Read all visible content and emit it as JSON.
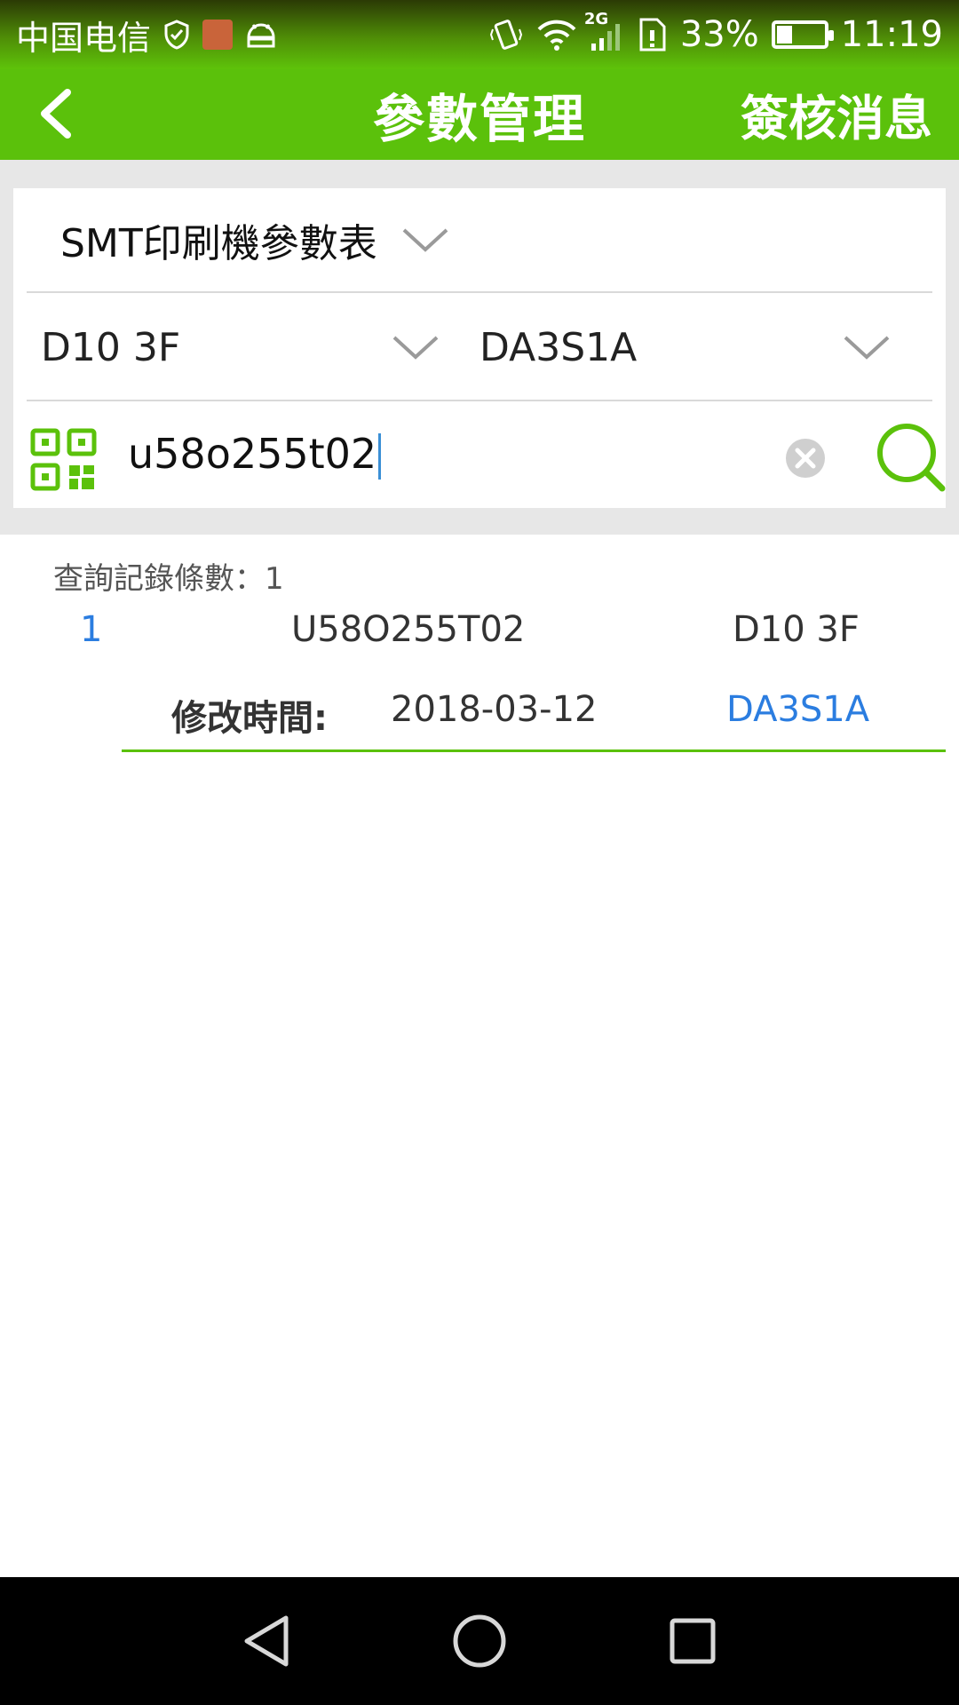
{
  "status_bar": {
    "carrier": "中国电信",
    "network_type": "2G",
    "battery_percent": "33%",
    "battery_level": 0.33,
    "time": "11:19"
  },
  "header": {
    "title": "參數管理",
    "action_label": "簽核消息"
  },
  "filters": {
    "table_select": "SMT印刷機參數表",
    "floor_select": "D10 3F",
    "line_select": "DA3S1A",
    "search_value": "u58o255t02"
  },
  "results": {
    "count_label": "查詢記錄條數：",
    "count_value": "1",
    "items": [
      {
        "index": "1",
        "code": "U58O255T02",
        "floor": "D10 3F",
        "time_label": "修改時間:",
        "time": "2018-03-12",
        "line": "DA3S1A"
      }
    ]
  },
  "colors": {
    "brand_green": "#5bc10b",
    "link_blue": "#2b7de0"
  }
}
